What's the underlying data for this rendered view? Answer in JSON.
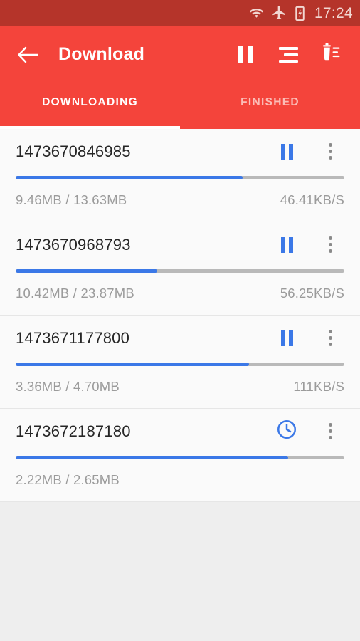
{
  "statusbar": {
    "time": "17:24",
    "icons": [
      "wifi-data-icon",
      "airplane-mode-icon",
      "battery-charging-icon"
    ]
  },
  "appbar": {
    "back_icon": "back-arrow-icon",
    "title": "Download",
    "actions": [
      {
        "name": "pause-all-button",
        "icon": "pause-icon"
      },
      {
        "name": "sort-button",
        "icon": "sort-lines-icon"
      },
      {
        "name": "delete-all-button",
        "icon": "trash-list-icon"
      }
    ]
  },
  "tabs": {
    "items": [
      {
        "label": "DOWNLOADING",
        "active": true
      },
      {
        "label": "FINISHED",
        "active": false
      }
    ],
    "indicator_color": "#ffffff"
  },
  "colors": {
    "statusbar": "#b5342a",
    "appbar": "#f4443b",
    "accent_blue": "#3b78e7",
    "list_bg": "#fafafa",
    "page_bg": "#eeeeee"
  },
  "downloads": [
    {
      "name": "1473670846985",
      "state_icon": "pause-icon",
      "progress_percent": 69,
      "downloaded": "9.46MB",
      "total": "13.63MB",
      "sizes": "9.46MB / 13.63MB",
      "speed": "46.41KB/S"
    },
    {
      "name": "1473670968793",
      "state_icon": "pause-icon",
      "progress_percent": 43,
      "downloaded": "10.42MB",
      "total": "23.87MB",
      "sizes": "10.42MB / 23.87MB",
      "speed": "56.25KB/S"
    },
    {
      "name": "1473671177800",
      "state_icon": "pause-icon",
      "progress_percent": 71,
      "downloaded": "3.36MB",
      "total": "4.70MB",
      "sizes": "3.36MB / 4.70MB",
      "speed": "111KB/S"
    },
    {
      "name": "1473672187180",
      "state_icon": "clock-icon",
      "progress_percent": 83,
      "downloaded": "2.22MB",
      "total": "2.65MB",
      "sizes": "2.22MB / 2.65MB",
      "speed": ""
    }
  ]
}
